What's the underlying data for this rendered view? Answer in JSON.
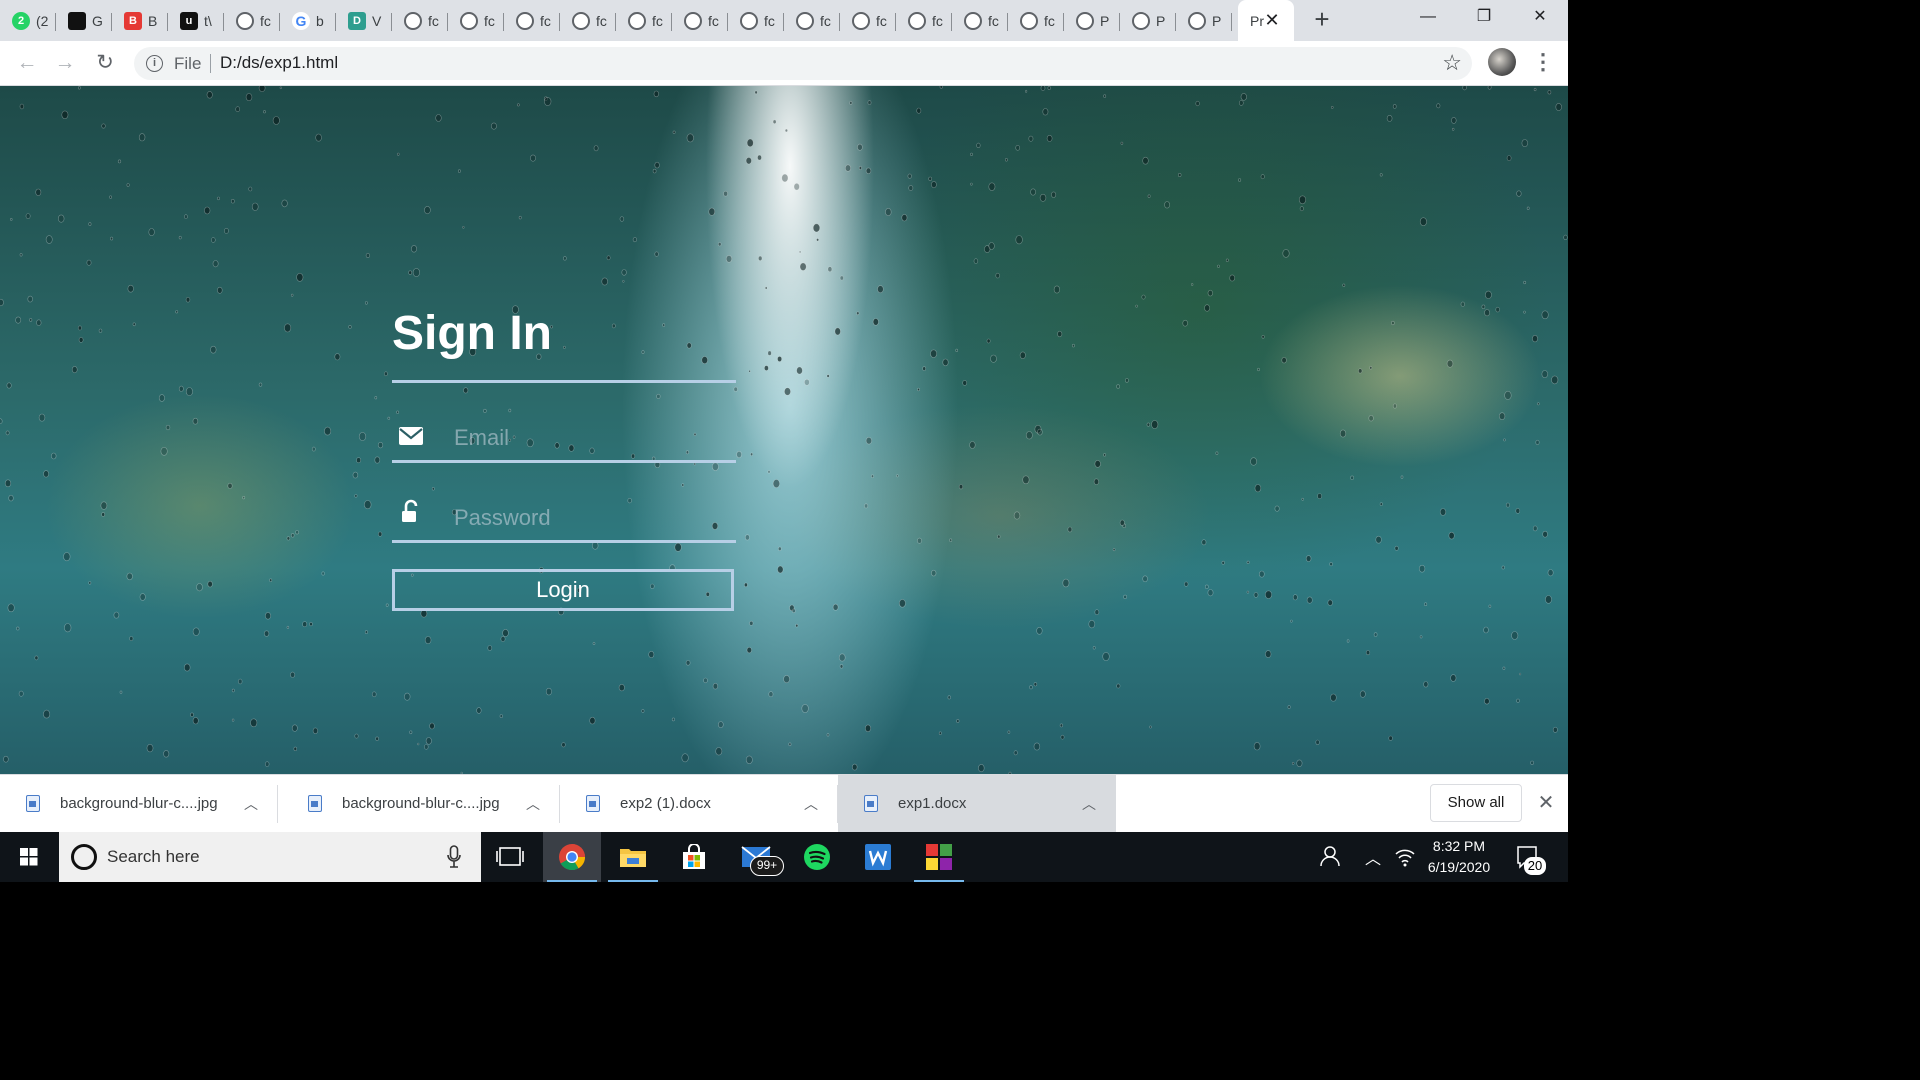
{
  "browser": {
    "tabs": [
      {
        "icon": "whatsapp-icon",
        "title": "(2",
        "color": "#25d366",
        "glyph": "2"
      },
      {
        "icon": "github-icon",
        "title": "G",
        "color": "#111111",
        "glyph": ""
      },
      {
        "icon": "app-red-icon",
        "title": "B",
        "color": "#e53935",
        "glyph": "B"
      },
      {
        "icon": "app-black-icon",
        "title": "t\\",
        "color": "#111111",
        "glyph": "u"
      },
      {
        "icon": "globe-icon",
        "title": "fc",
        "color": "#5f6368",
        "glyph": ""
      },
      {
        "icon": "google-icon",
        "title": "b",
        "color": "#4285f4",
        "glyph": "G"
      },
      {
        "icon": "app-teal-icon",
        "title": "V",
        "color": "#2e9e8f",
        "glyph": "D"
      },
      {
        "icon": "globe-icon",
        "title": "fc",
        "color": "#5f6368",
        "glyph": ""
      },
      {
        "icon": "globe-icon",
        "title": "fc",
        "color": "#5f6368",
        "glyph": ""
      },
      {
        "icon": "globe-icon",
        "title": "fc",
        "color": "#5f6368",
        "glyph": ""
      },
      {
        "icon": "globe-icon",
        "title": "fc",
        "color": "#5f6368",
        "glyph": ""
      },
      {
        "icon": "globe-icon",
        "title": "fc",
        "color": "#5f6368",
        "glyph": ""
      },
      {
        "icon": "globe-icon",
        "title": "fc",
        "color": "#5f6368",
        "glyph": ""
      },
      {
        "icon": "globe-icon",
        "title": "fc",
        "color": "#5f6368",
        "glyph": ""
      },
      {
        "icon": "globe-icon",
        "title": "fc",
        "color": "#5f6368",
        "glyph": ""
      },
      {
        "icon": "globe-icon",
        "title": "fc",
        "color": "#5f6368",
        "glyph": ""
      },
      {
        "icon": "globe-icon",
        "title": "fc",
        "color": "#5f6368",
        "glyph": ""
      },
      {
        "icon": "globe-icon",
        "title": "fc",
        "color": "#5f6368",
        "glyph": ""
      },
      {
        "icon": "globe-icon",
        "title": "fc",
        "color": "#5f6368",
        "glyph": ""
      },
      {
        "icon": "globe-icon",
        "title": "P",
        "color": "#5f6368",
        "glyph": ""
      },
      {
        "icon": "globe-icon",
        "title": "P",
        "color": "#5f6368",
        "glyph": ""
      },
      {
        "icon": "globe-icon",
        "title": "P",
        "color": "#5f6368",
        "glyph": ""
      }
    ],
    "active_tab": {
      "title": "Pr",
      "close_glyph": "✕"
    },
    "new_tab_glyph": "+",
    "window_controls": {
      "minimize": "—",
      "restore": "❐",
      "close": "✕"
    },
    "toolbar": {
      "back_glyph": "←",
      "forward_glyph": "→",
      "reload_glyph": "↻",
      "scheme_label": "File",
      "url": "D:/ds/exp1.html",
      "bookmark_glyph": "☆",
      "menu_glyph": "⋮"
    }
  },
  "page": {
    "title": "Sign In",
    "email": {
      "placeholder": "Email",
      "value": ""
    },
    "password": {
      "placeholder": "Password",
      "value": ""
    },
    "login_label": "Login"
  },
  "downloads": {
    "items": [
      {
        "name": "background-blur-c....jpg",
        "type": "image"
      },
      {
        "name": "background-blur-c....jpg",
        "type": "image"
      },
      {
        "name": "exp2 (1).docx",
        "type": "word"
      },
      {
        "name": "exp1.docx",
        "type": "word"
      }
    ],
    "show_all_label": "Show all",
    "close_glyph": "✕"
  },
  "taskbar": {
    "search_placeholder": "Search here",
    "mail_badge": "99+",
    "clock_time": "8:32 PM",
    "clock_date": "6/19/2020",
    "notification_count": "20"
  },
  "colors": {
    "accent_line": "#b7cfe6",
    "tab_strip": "#dee1e6",
    "taskbar": "#0f1419"
  }
}
